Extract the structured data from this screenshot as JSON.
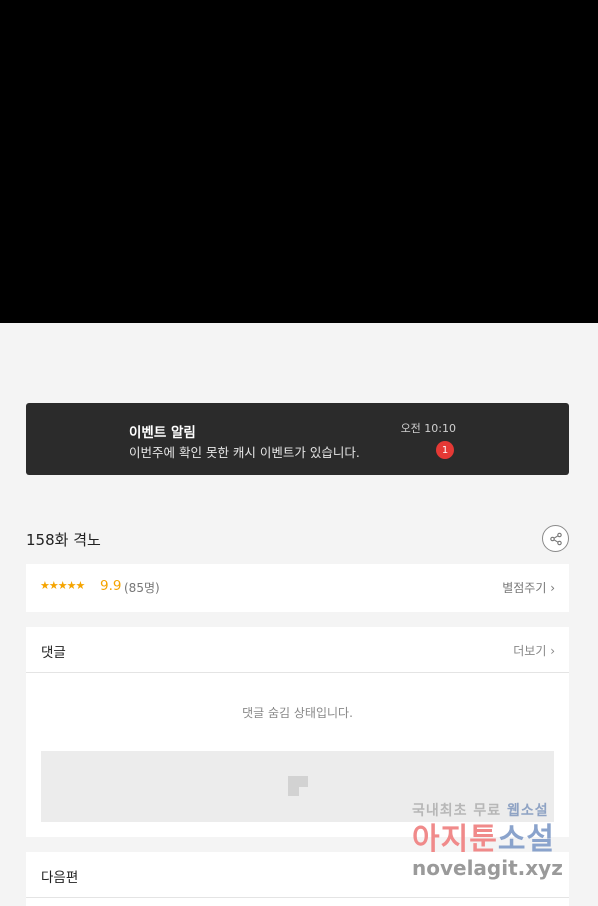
{
  "notification": {
    "title": "이벤트 알림",
    "message": "이번주에 확인 못한 캐시 이벤트가 있습니다.",
    "time": "오전 10:10",
    "badge": "1"
  },
  "episode": {
    "title": "158화 격노",
    "share_icon": "share-icon"
  },
  "rating": {
    "stars": "★★★★★",
    "score": "9.9",
    "count": "(85명)",
    "rate_link": "별점주기 ›"
  },
  "comments": {
    "title": "댓글",
    "more": "더보기 ›",
    "hidden_message": "댓글 숨김 상태입니다."
  },
  "next": {
    "title": "다음편"
  },
  "watermark": {
    "line1_a": "국내최초 무료 ",
    "line1_b": "웹소설",
    "line2_a": "아지툰",
    "line2_b": "소설",
    "line3": "novelagit.xyz"
  },
  "colors": {
    "accent_star": "#f5a400",
    "badge_red": "#e53935",
    "notification_bg": "#2b2b2b"
  }
}
